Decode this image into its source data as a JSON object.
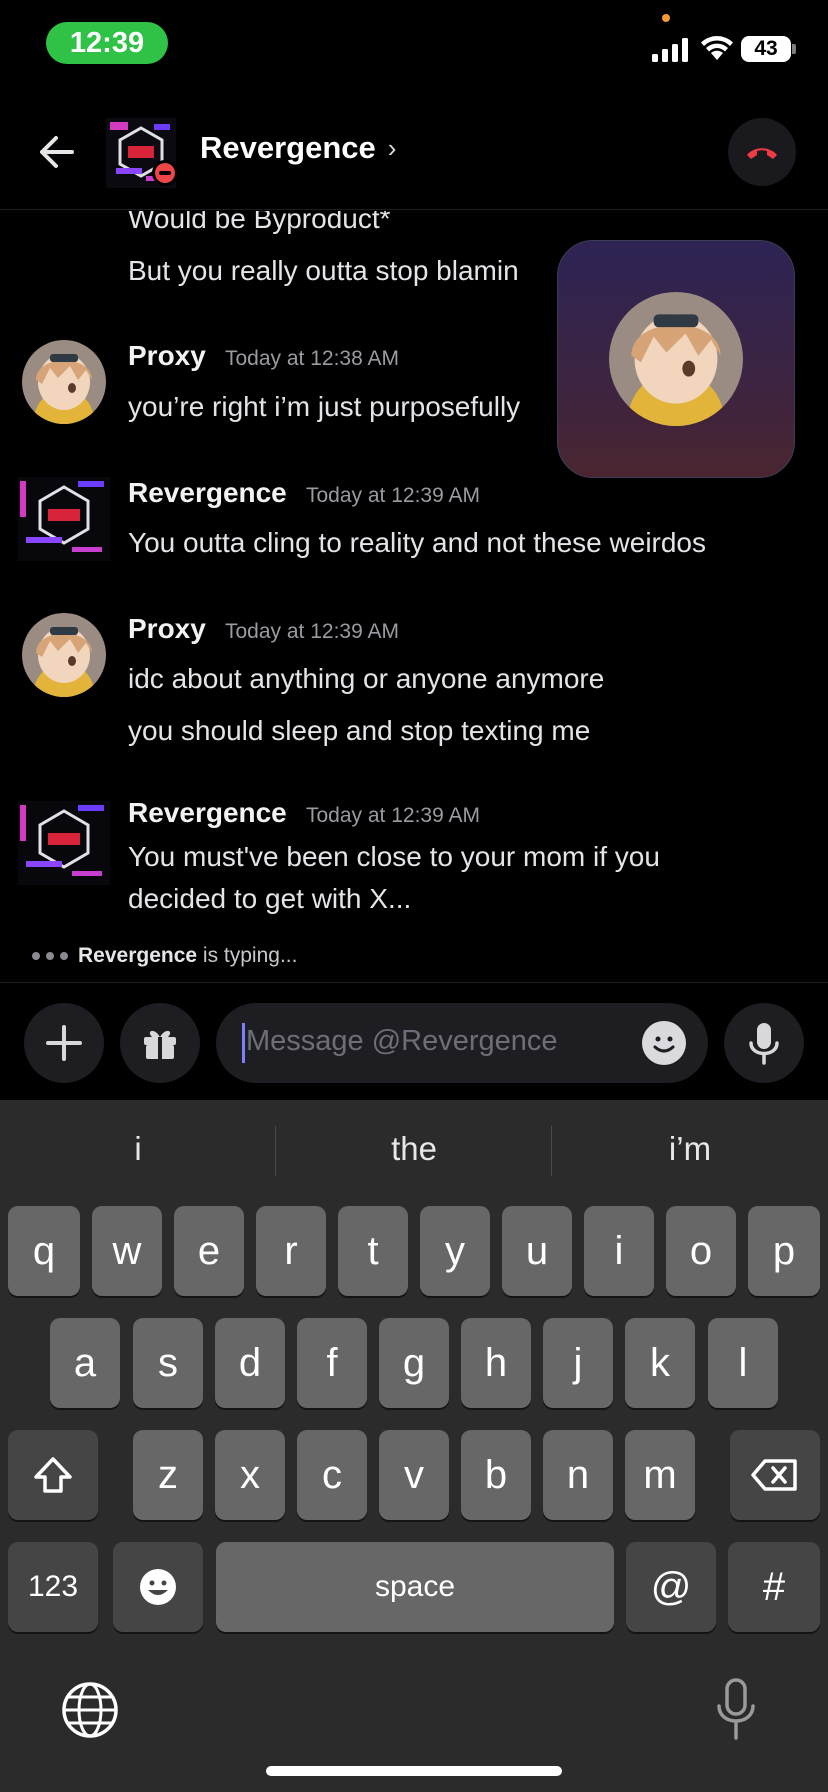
{
  "status_bar": {
    "time": "12:39",
    "battery": "43"
  },
  "header": {
    "title": "Revergence",
    "chevron": "›"
  },
  "messages": [
    {
      "author": "",
      "time": "",
      "lines": [
        "Would be Byproduct*",
        "But you really outta stop blamin"
      ]
    },
    {
      "author": "Proxy",
      "time": "Today at 12:38 AM",
      "lines": [
        "you’re right i’m just purposefully"
      ]
    },
    {
      "author": "Revergence",
      "time": "Today at 12:39 AM",
      "lines": [
        "You outta cling to reality and not these weirdos"
      ]
    },
    {
      "author": "Proxy",
      "time": "Today at 12:39 AM",
      "lines": [
        "idc about anything or anyone anymore",
        "you should sleep and stop texting me"
      ]
    },
    {
      "author": "Revergence",
      "time": "Today at 12:39 AM",
      "lines": [
        "You must've been close to your mom if you",
        "decided to get with X..."
      ]
    }
  ],
  "typing": {
    "name": "Revergence",
    "suffix": " is typing..."
  },
  "composer": {
    "placeholder": "Message @Revergence"
  },
  "keyboard": {
    "suggestions": [
      "i",
      "the",
      "i’m"
    ],
    "row1": [
      "q",
      "w",
      "e",
      "r",
      "t",
      "y",
      "u",
      "i",
      "o",
      "p"
    ],
    "row2": [
      "a",
      "s",
      "d",
      "f",
      "g",
      "h",
      "j",
      "k",
      "l"
    ],
    "row3": [
      "z",
      "x",
      "c",
      "v",
      "b",
      "n",
      "m"
    ],
    "numbers_key": "123",
    "space_key": "space",
    "at_key": "@",
    "hash_key": "#"
  },
  "icons": {
    "back": "arrow-left-icon",
    "end_call": "phone-hangup-icon",
    "add": "plus-icon",
    "gift": "gift-icon",
    "emoji": "smile-icon",
    "mic": "microphone-icon",
    "shift": "shift-icon",
    "backspace": "backspace-icon",
    "globe": "globe-icon"
  },
  "colors": {
    "time_pill": "#30c247",
    "end_call_red": "#ee3b44",
    "dnd_red": "#ee4548",
    "caret": "#7d7fff"
  }
}
